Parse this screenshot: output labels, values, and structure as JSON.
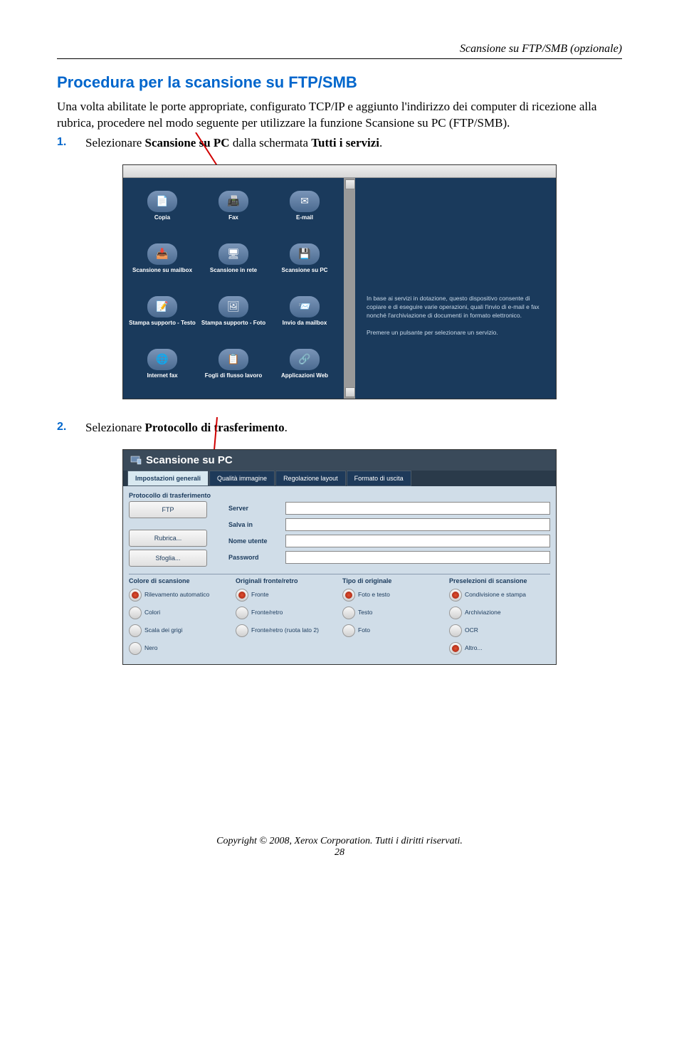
{
  "header": "Scansione su FTP/SMB (opzionale)",
  "section_title": "Procedura per la scansione su FTP/SMB",
  "intro": "Una volta abilitate le porte appropriate, configurato TCP/IP e aggiunto l'indirizzo dei computer di ricezione alla rubrica, procedere nel modo seguente per utilizzare la funzione Scansione su PC (FTP/SMB).",
  "step1": {
    "num": "1.",
    "pre": "Selezionare ",
    "bold1": "Scansione su PC",
    "mid": " dalla schermata ",
    "bold2": "Tutti i servizi",
    "post": "."
  },
  "step2": {
    "num": "2.",
    "pre": "Selezionare ",
    "bold1": "Protocollo di trasferimento",
    "post": "."
  },
  "ss1": {
    "services": [
      {
        "icon": "📄",
        "label": "Copia"
      },
      {
        "icon": "📠",
        "label": "Fax"
      },
      {
        "icon": "✉",
        "label": "E-mail"
      },
      {
        "icon": "📥",
        "label": "Scansione su mailbox"
      },
      {
        "icon": "🖥",
        "label": "Scansione in rete"
      },
      {
        "icon": "💾",
        "label": "Scansione su PC"
      },
      {
        "icon": "📝",
        "label": "Stampa supporto - Testo"
      },
      {
        "icon": "🖼",
        "label": "Stampa supporto - Foto"
      },
      {
        "icon": "📨",
        "label": "Invio da mailbox"
      },
      {
        "icon": "🌐",
        "label": "Internet fax"
      },
      {
        "icon": "📋",
        "label": "Fogli di flusso lavoro"
      },
      {
        "icon": "🔗",
        "label": "Applicazioni Web"
      }
    ],
    "info1": "In base ai servizi in dotazione, questo dispositivo consente di copiare e di eseguire varie operazioni, quali l'invio di e-mail e fax nonché l'archiviazione di documenti in formato elettronico.",
    "info2": "Premere un pulsante per selezionare un servizio."
  },
  "ss2": {
    "title": "Scansione su PC",
    "tabs": [
      "Impostazioni generali",
      "Qualità immagine",
      "Regolazione layout",
      "Formato di uscita"
    ],
    "proto_label": "Protocollo di trasferimento",
    "proto_btn_value": "FTP",
    "rubrica_btn": "Rubrica...",
    "sfoglia_btn": "Sfoglia...",
    "fields": [
      "Server",
      "Salva in",
      "Nome utente",
      "Password"
    ],
    "col1": {
      "title": "Colore di scansione",
      "opts": [
        "Rilevamento automatico",
        "Colori",
        "Scala dei grigi",
        "Nero"
      ]
    },
    "col2": {
      "title": "Originali fronte/retro",
      "opts": [
        "Fronte",
        "Fronte/retro",
        "Fronte/retro (ruota lato 2)"
      ]
    },
    "col3": {
      "title": "Tipo di originale",
      "opts": [
        "Foto e testo",
        "Testo",
        "Foto"
      ]
    },
    "col4": {
      "title": "Preselezioni di scansione",
      "opts": [
        "Condivisione e stampa",
        "Archiviazione",
        "OCR",
        "Altro..."
      ]
    }
  },
  "footer": "Copyright © 2008, Xerox Corporation. Tutti i diritti riservati.",
  "page": "28"
}
